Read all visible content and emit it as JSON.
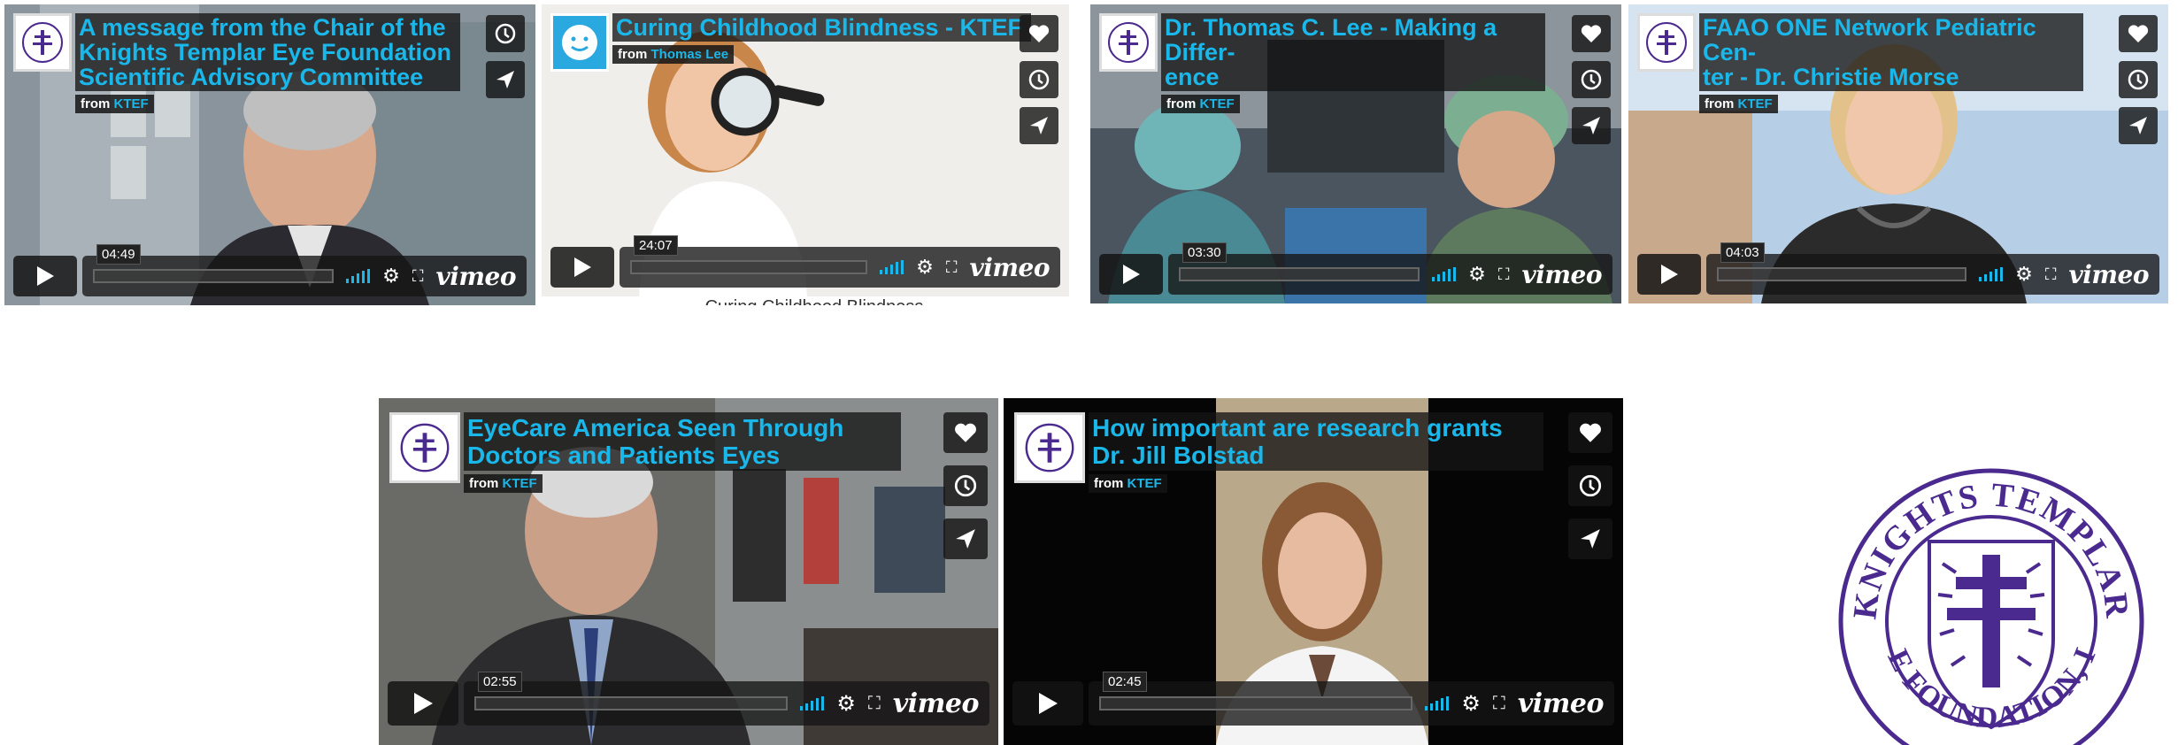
{
  "videos": [
    {
      "title_lines": [
        "A message from the Chair of the",
        "Knights Templar Eye Foundation",
        "Scientific Advisory Committee"
      ],
      "from_label": "from",
      "from_name": "KTEF",
      "duration": "04:49",
      "side_buttons": [
        "clock-icon",
        "send-icon"
      ]
    },
    {
      "title_lines": [
        "Curing Childhood Blindness - KTEF"
      ],
      "from_label": "from",
      "from_name": "Thomas Lee",
      "duration": "24:07",
      "side_buttons": [
        "heart-icon",
        "clock-icon",
        "send-icon"
      ]
    },
    {
      "title_lines": [
        "Dr. Thomas C. Lee - Making a Differ-",
        "ence"
      ],
      "from_label": "from",
      "from_name": "KTEF",
      "duration": "03:30",
      "side_buttons": [
        "heart-icon",
        "clock-icon",
        "send-icon"
      ]
    },
    {
      "title_lines": [
        "FAAO ONE Network Pediatric Cen-",
        "ter - Dr. Christie Morse"
      ],
      "from_label": "from",
      "from_name": "KTEF",
      "duration": "04:03",
      "side_buttons": [
        "heart-icon",
        "clock-icon",
        "send-icon"
      ]
    },
    {
      "title_lines": [
        "EyeCare America Seen Through",
        "Doctors and Patients Eyes"
      ],
      "from_label": "from",
      "from_name": "KTEF",
      "duration": "02:55",
      "side_buttons": [
        "heart-icon",
        "clock-icon",
        "send-icon"
      ]
    },
    {
      "title_lines": [
        "How important are research grants",
        "Dr. Jill Bolstad"
      ],
      "from_label": "from",
      "from_name": "KTEF",
      "duration": "02:45",
      "side_buttons": [
        "heart-icon",
        "clock-icon",
        "send-icon"
      ]
    }
  ],
  "vimeo_brand": "vimeo",
  "caption_partial": "Curing Childhood Blindness",
  "logo": {
    "top_text": "KNIGHTS TEMPLAR",
    "bottom_text": "EYE FOUNDATION, Inc."
  },
  "colors": {
    "accent": "#1ab7ea",
    "logo_purple": "#4b2a8f"
  }
}
